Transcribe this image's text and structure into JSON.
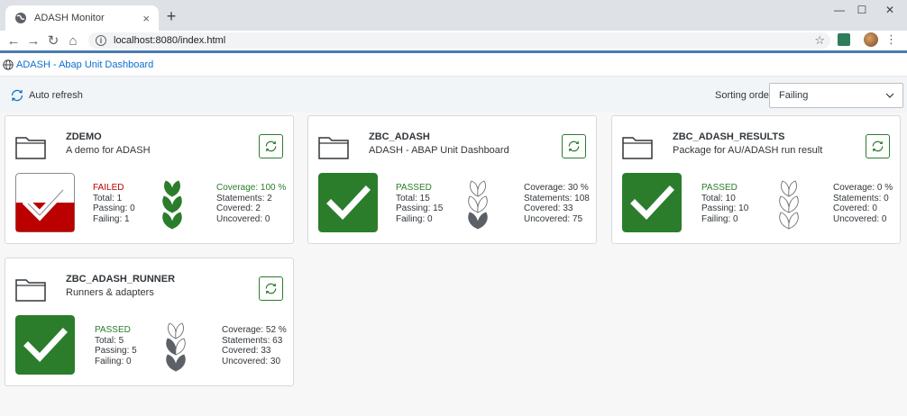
{
  "browser": {
    "tab_title": "ADASH Monitor",
    "tab_close": "×",
    "new_tab": "+",
    "url": "localhost:8080/index.html",
    "win_minimize": "—",
    "win_maximize": "☐",
    "win_close": "✕"
  },
  "app": {
    "title": "ADASH - Abap Unit Dashboard",
    "auto_refresh_label": "Auto refresh",
    "sort_label": "Sorting order",
    "sort_value": "Failing"
  },
  "colors": {
    "accent": "#4a7bb0",
    "pass_green": "#2b7d2b",
    "fail_red": "#bb0000",
    "link_blue": "#0a6ed1"
  },
  "packages": [
    {
      "name": "ZDEMO",
      "description": "A demo for ADASH",
      "status": "FAILED",
      "status_key": "failed",
      "total": "Total: 1",
      "passing": "Passing: 0",
      "failing": "Failing: 1",
      "fail_ratio": 0.5,
      "coverage": "Coverage: 100 %",
      "coverage_pct": 100,
      "statements": "Statements: 2",
      "covered": "Covered: 2",
      "uncovered": "Uncovered: 0"
    },
    {
      "name": "ZBC_ADASH",
      "description": "ADASH - ABAP Unit Dashboard",
      "status": "PASSED",
      "status_key": "passed",
      "total": "Total: 15",
      "passing": "Passing: 15",
      "failing": "Failing: 0",
      "coverage": "Coverage: 30 %",
      "coverage_pct": 30,
      "statements": "Statements: 108",
      "covered": "Covered: 33",
      "uncovered": "Uncovered: 75"
    },
    {
      "name": "ZBC_ADASH_RESULTS",
      "description": "Package for AU/ADASH run result",
      "status": "PASSED",
      "status_key": "passed",
      "total": "Total: 10",
      "passing": "Passing: 10",
      "failing": "Failing: 0",
      "coverage": "Coverage: 0 %",
      "coverage_pct": 0,
      "statements": "Statements: 0",
      "covered": "Covered: 0",
      "uncovered": "Uncovered: 0"
    },
    {
      "name": "ZBC_ADASH_RUNNER",
      "description": "Runners & adapters",
      "status": "PASSED",
      "status_key": "passed",
      "total": "Total: 5",
      "passing": "Passing: 5",
      "failing": "Failing: 0",
      "coverage": "Coverage: 52 %",
      "coverage_pct": 52,
      "statements": "Statements: 63",
      "covered": "Covered: 33",
      "uncovered": "Uncovered: 30"
    }
  ]
}
